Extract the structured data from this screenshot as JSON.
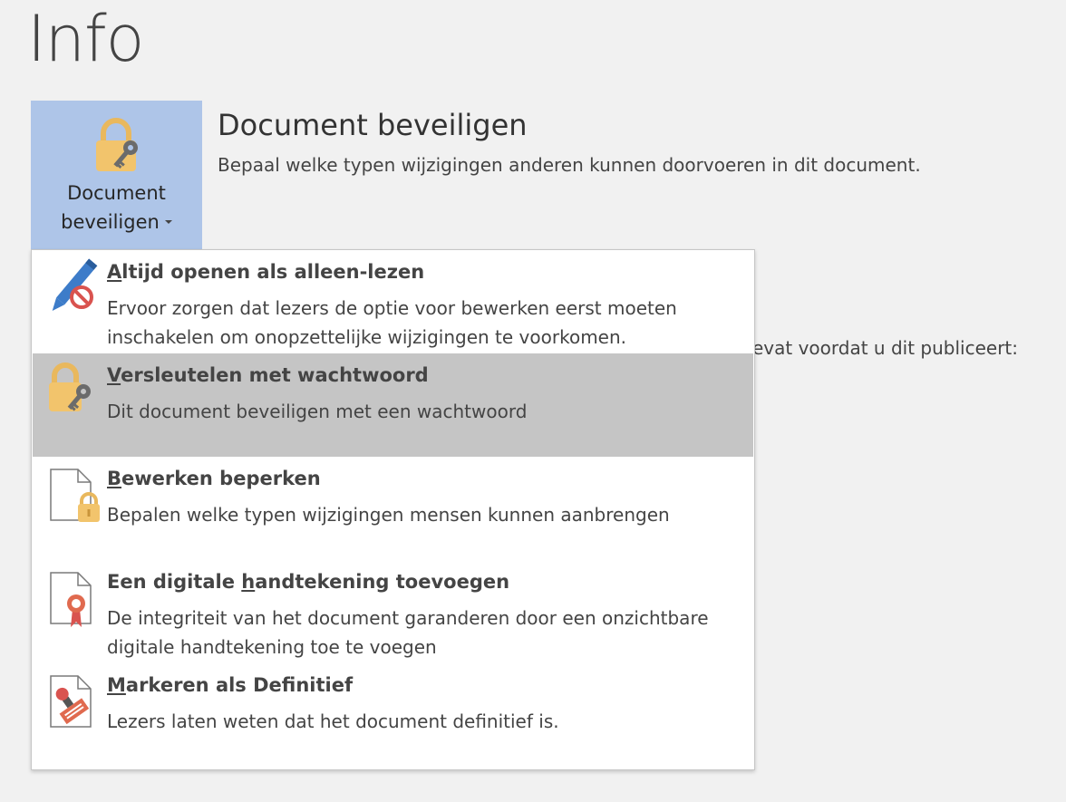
{
  "page": {
    "title": "Info"
  },
  "protect_button": {
    "line1": "Document",
    "line2": "beveiligen"
  },
  "section": {
    "title": "Document beveiligen",
    "description": "Bepaal welke typen wijzigingen anderen kunnen doorvoeren in dit document."
  },
  "background_text": "evat voordat u dit publiceert:",
  "menu": {
    "items": [
      {
        "access_key": "A",
        "title_rest": "ltijd openen als alleen-lezen",
        "description": "Ervoor zorgen dat lezers de optie voor bewerken eerst moeten inschakelen om onopzettelijke wijzigingen te voorkomen.",
        "icon": "pencil-no-icon"
      },
      {
        "access_key": "V",
        "title_rest": "ersleutelen met wachtwoord",
        "description": "Dit document beveiligen met een wachtwoord",
        "icon": "lock-key-icon",
        "highlighted": true
      },
      {
        "access_key": "B",
        "title_rest": "ewerken beperken",
        "description": "Bepalen welke typen wijzigingen mensen kunnen aanbrengen",
        "icon": "document-lock-icon"
      },
      {
        "title_pre": "Een digitale ",
        "access_key": "h",
        "title_rest": "andtekening toevoegen",
        "description": "De integriteit van het document garanderen door een onzichtbare digitale handtekening toe te voegen",
        "icon": "document-ribbon-icon"
      },
      {
        "access_key": "M",
        "title_rest": "arkeren als Definitief",
        "description": "Lezers laten weten dat het document definitief is.",
        "icon": "document-stamp-icon"
      }
    ]
  },
  "colors": {
    "background": "#f1f1f1",
    "button_active": "#aec5e8",
    "menu_highlight": "#c5c5c5",
    "lock_gold": "#f2c46c",
    "pencil_blue": "#3d7cc9",
    "alert_red": "#d9534f"
  }
}
